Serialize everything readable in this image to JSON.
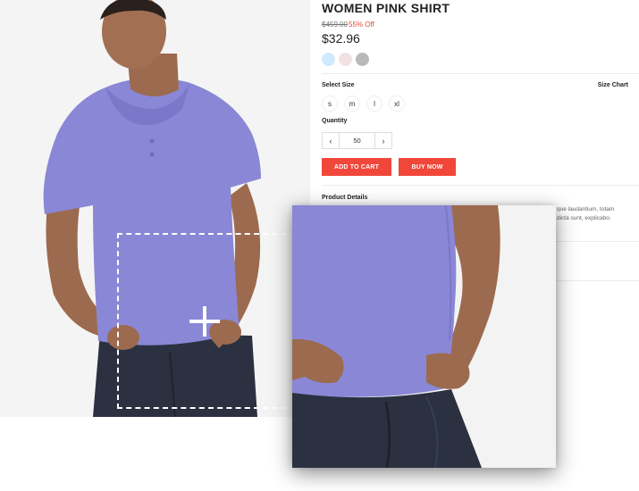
{
  "product": {
    "title": "WOMEN PINK SHIRT",
    "old_price": "$459.00",
    "discount": "55% Off",
    "price": "$32.96",
    "swatches": [
      {
        "color": "#cfe9ff"
      },
      {
        "color": "#f2e1e4"
      },
      {
        "color": "#b9b9b9"
      }
    ]
  },
  "size": {
    "label": "Select Size",
    "chart_link": "Size Chart",
    "options": [
      "s",
      "m",
      "l",
      "xl"
    ]
  },
  "quantity": {
    "label": "Quantity",
    "value": "50",
    "decrement": "‹",
    "increment": "›"
  },
  "actions": {
    "add_to_cart": "ADD TO CART",
    "buy_now": "BUY NOW"
  },
  "details": {
    "label": "Product Details",
    "line1": "que laudantium, totam",
    "line2": "dicta sunt, explicabo."
  },
  "zoom": {
    "lens_icon": "plus-icon"
  },
  "colors": {
    "accent": "#f0473a",
    "discount": "#e8463a",
    "shirt": "#8a87d6",
    "jeans": "#2b3140"
  }
}
